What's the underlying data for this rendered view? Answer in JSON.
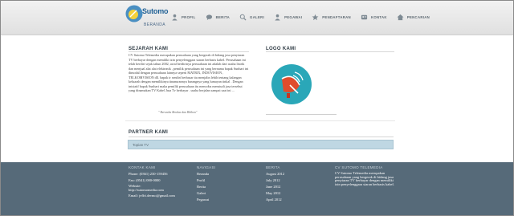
{
  "brand": {
    "name": "Sutomo",
    "subtitle": "BERANDA"
  },
  "nav": [
    {
      "label": "PROFIL",
      "icon": "person-icon"
    },
    {
      "label": "BERITA",
      "icon": "chat-icon"
    },
    {
      "label": "GALERI",
      "icon": "search-icon"
    },
    {
      "label": "PEGAWAI",
      "icon": "person-icon"
    },
    {
      "label": "PENDAFTARAN",
      "icon": "star-icon"
    },
    {
      "label": "KONTAK",
      "icon": "contact-icon"
    },
    {
      "label": "PENCARIAN",
      "icon": "home-icon"
    }
  ],
  "history": {
    "title": "SEJARAH KAMI",
    "body": "CV Sutomo Telemedia merupakan perusahaan yang bergerak di bidang jasa penyiaran TV berbayar dengan memiliki izin penyelenggara siaran berbasis kabel. Perusahaan ini telah berdiri sejak tahun 2002, awal berdirinya perusahaan ini adalah dari usaha listrik dan menjual alat alat elektronik , pemilik perusahaan ini yang bernama bapak Sunhari ini dimodal dengan perusahaan lainnya seperti MATRIX, INDOVISION , TELKOMVISION dll. bapak ir sendiri berbasar itu menjalin lebih tentang kalangan keluarah dengan memilikinya tinanurannya barangnya yang lumayan tinkal . Dengan inisiatif bapak Sunhari maka pemilik perusahaan itu mencoba menstudi jasa tersebut yang dinamakan TV Kabel Jasa Tv berbayar . usaha berjalan sampai saat ini ...",
    "quote": "\" Berwaha Berdua dan Ribbon\""
  },
  "logo": {
    "title": "LOGO KAMI"
  },
  "partners": {
    "title": "PARTNER KAMI",
    "items": [
      "Topian TV"
    ]
  },
  "footer": {
    "contact": {
      "heading": "KONTAK KAMI",
      "phone": "Phone: (0361) 230-159456",
      "fax": "Fax: (0541) 000-0000",
      "website": "Website: http://sutomomedia.com",
      "email": "Email: jeffri.dermo@gmail.com"
    },
    "navigation": {
      "heading": "NAVIGASI",
      "items": [
        "Beranda",
        "Profil",
        "Berita",
        "Galeri",
        "Pegawai"
      ]
    },
    "news": {
      "heading": "BERITA",
      "items": [
        "August 2012",
        "July 2012",
        "June 2012",
        "May 2012",
        "April 2012"
      ]
    },
    "about": {
      "heading": "CV SUTOMO TELEMEDIA",
      "body": "CV Sutomo Telemedia merupakan perusahaan yang bergerak di bidang jasa penyiaran TV berbayar dengan memiliki izin penyelenggara siaran berbasis kabel."
    }
  },
  "colors": {
    "accent": "#1e5f94",
    "footer": "#566a79",
    "partner_bar": "#bfd7e3",
    "logo_red": "#e04c2d",
    "logo_teal": "#2aa7b8"
  }
}
